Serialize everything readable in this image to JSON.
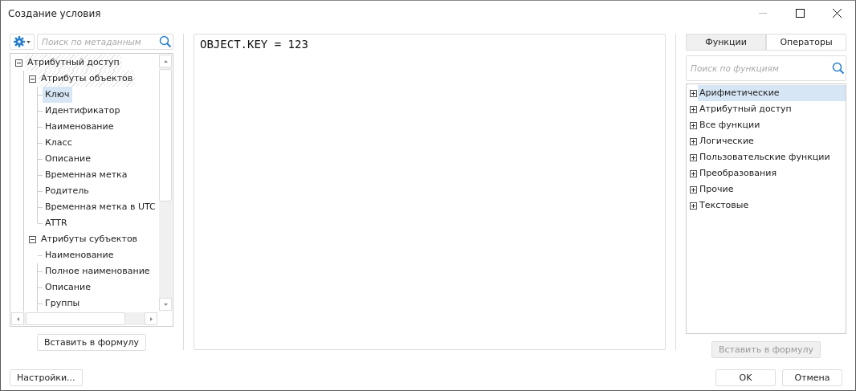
{
  "window": {
    "title": "Создание условия"
  },
  "metadata_panel": {
    "search": {
      "placeholder": "Поиск по метаданным"
    },
    "tree": [
      {
        "label": "Атрибутный доступ",
        "expanded": true,
        "hatched": true,
        "selected": false,
        "children": [
          {
            "label": "Атрибуты объектов",
            "expanded": true,
            "hatched": true,
            "selected": false,
            "children": [
              {
                "label": "Ключ",
                "selected": true
              },
              {
                "label": "Идентификатор",
                "selected": false
              },
              {
                "label": "Наименование",
                "selected": false
              },
              {
                "label": "Класс",
                "selected": false
              },
              {
                "label": "Описание",
                "selected": false
              },
              {
                "label": "Временная метка",
                "selected": false
              },
              {
                "label": "Родитель",
                "selected": false
              },
              {
                "label": "Временная метка в UTC",
                "selected": false
              },
              {
                "label": "ATTR",
                "selected": false
              }
            ]
          },
          {
            "label": "Атрибуты субъектов",
            "expanded": true,
            "hatched": false,
            "selected": false,
            "children": [
              {
                "label": "Наименование",
                "selected": false
              },
              {
                "label": "Полное наименование",
                "selected": false
              },
              {
                "label": "Описание",
                "selected": false
              },
              {
                "label": "Группы",
                "selected": false
              }
            ]
          }
        ]
      }
    ],
    "insert_button": {
      "label": "Вставить в формулу",
      "disabled": false
    }
  },
  "editor": {
    "value": "OBJECT.KEY = 123"
  },
  "functions_panel": {
    "tabs": [
      {
        "label": "Функции",
        "selected": true
      },
      {
        "label": "Операторы",
        "selected": false
      }
    ],
    "search": {
      "placeholder": "Поиск по функциям"
    },
    "items": [
      {
        "label": "Арифметические",
        "expanded": false,
        "selected": true
      },
      {
        "label": "Атрибутный доступ",
        "expanded": false,
        "selected": false
      },
      {
        "label": "Все функции",
        "expanded": false,
        "selected": false
      },
      {
        "label": "Логические",
        "expanded": false,
        "selected": false
      },
      {
        "label": "Пользовательские функции",
        "expanded": false,
        "selected": false
      },
      {
        "label": "Преобразования",
        "expanded": false,
        "selected": false
      },
      {
        "label": "Прочие",
        "expanded": false,
        "selected": false
      },
      {
        "label": "Текстовые",
        "expanded": false,
        "selected": false
      }
    ],
    "insert_button": {
      "label": "Вставить в формулу",
      "disabled": true
    }
  },
  "buttons": {
    "settings": "Настройки...",
    "ok": "OK",
    "cancel": "Отмена"
  }
}
